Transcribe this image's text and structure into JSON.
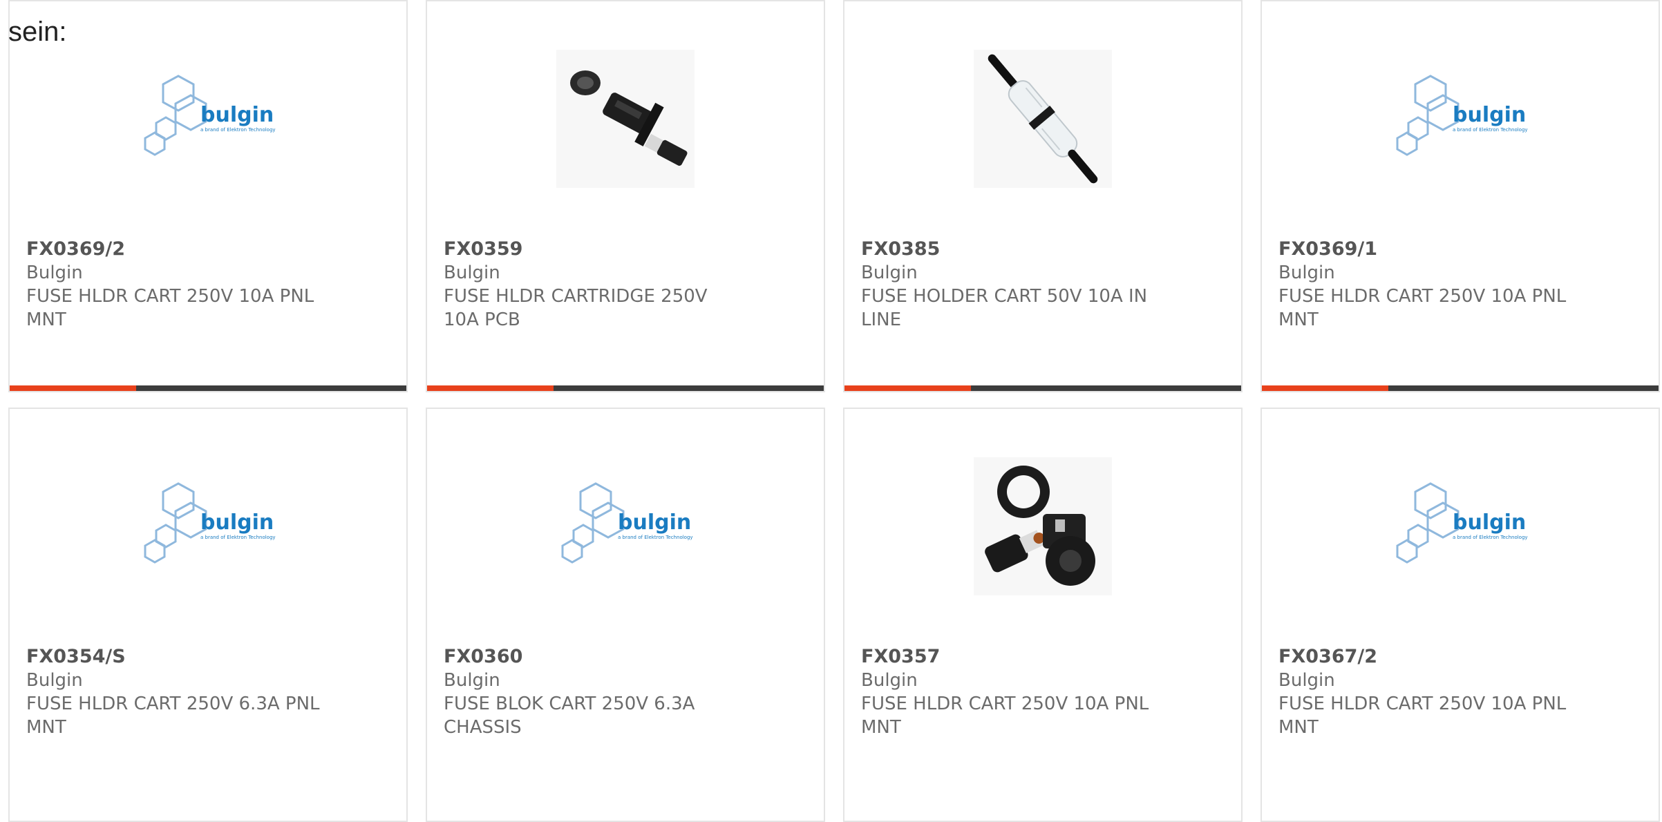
{
  "intro_text": "sein:",
  "colors": {
    "accent": "#e8411b",
    "bar_dark": "#3c3c3c",
    "bulgin_blue": "#1a7cc1",
    "bulgin_light": "#8fb8dd"
  },
  "products": [
    {
      "part": "FX0369/2",
      "brand": "Bulgin",
      "desc1": "FUSE HLDR CART 250V 10A PNL",
      "desc2": "MNT",
      "image": "bulgin-logo"
    },
    {
      "part": "FX0359",
      "brand": "Bulgin",
      "desc1": "FUSE HLDR CARTRIDGE 250V",
      "desc2": "10A PCB",
      "image": "panel-fuse-holder-photo"
    },
    {
      "part": "FX0385",
      "brand": "Bulgin",
      "desc1": "FUSE HOLDER CART 50V 10A IN",
      "desc2": "LINE",
      "image": "inline-fuse-holder-photo"
    },
    {
      "part": "FX0369/1",
      "brand": "Bulgin",
      "desc1": "FUSE HLDR CART 250V 10A PNL",
      "desc2": "MNT",
      "image": "bulgin-logo"
    },
    {
      "part": "FX0354/S",
      "brand": "Bulgin",
      "desc1": "FUSE HLDR CART 250V 6.3A PNL",
      "desc2": "MNT",
      "image": "bulgin-logo"
    },
    {
      "part": "FX0360",
      "brand": "Bulgin",
      "desc1": "FUSE BLOK CART 250V 6.3A",
      "desc2": "CHASSIS",
      "image": "bulgin-logo"
    },
    {
      "part": "FX0357",
      "brand": "Bulgin",
      "desc1": "FUSE HLDR CART 250V 10A PNL",
      "desc2": "MNT",
      "image": "panel-fuse-holder-parts-photo"
    },
    {
      "part": "FX0367/2",
      "brand": "Bulgin",
      "desc1": "FUSE HLDR CART 250V 10A PNL",
      "desc2": "MNT",
      "image": "bulgin-logo"
    }
  ],
  "logo": {
    "wordmark": "bulgin",
    "tagline": "a brand of Elektron Technology"
  }
}
